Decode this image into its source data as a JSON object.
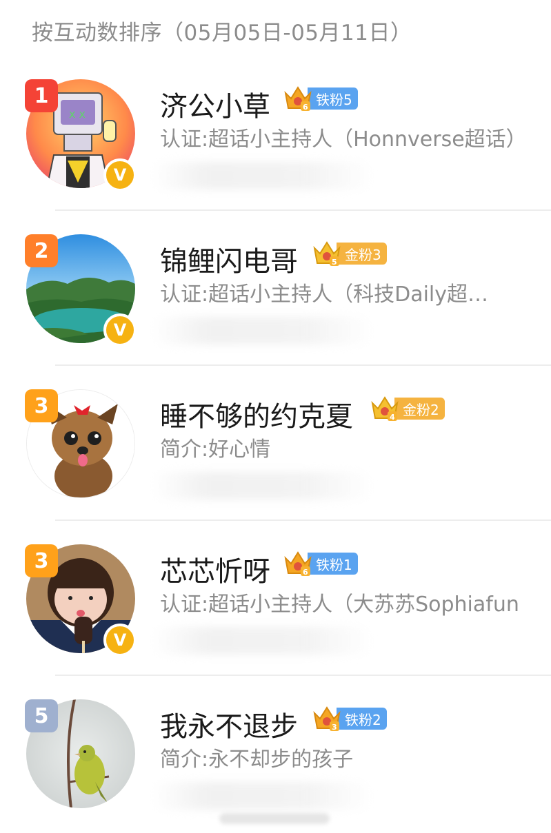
{
  "header": {
    "sort_text": "按互动数排序（05月05日-05月11日）"
  },
  "colors": {
    "rank_red": "#f44336",
    "rank_orange": "#ff7f2a",
    "rank_amber": "#ffa11a",
    "rank_gray": "#9fb0cf",
    "iron_fan": "#5aa3f0",
    "gold_fan": "#f5b340",
    "verified": "#f6b212"
  },
  "users": [
    {
      "rank": "1",
      "name": "济公小草",
      "fan_badge": "铁粉5",
      "fan_level_digit": "6",
      "desc": "认证:超话小主持人（Honnverse超话）",
      "verified": "V",
      "avatar_icon": "robot-avatar"
    },
    {
      "rank": "2",
      "name": "锦鲤闪电哥",
      "fan_badge": "金粉3",
      "fan_level_digit": "5",
      "desc": "认证:超话小主持人（科技Daily超…",
      "verified": "V",
      "avatar_icon": "landscape-avatar"
    },
    {
      "rank": "3",
      "name": "睡不够的约克夏",
      "fan_badge": "金粉2",
      "fan_level_digit": "4",
      "desc": "简介:好心情",
      "avatar_icon": "dog-avatar"
    },
    {
      "rank": "3",
      "name": "芯芯忻呀",
      "fan_badge": "铁粉1",
      "fan_level_digit": "6",
      "desc": "认证:超话小主持人（大苏苏Sophiafun",
      "verified": "V",
      "avatar_icon": "girl-avatar"
    },
    {
      "rank": "5",
      "name": "我永不退步",
      "fan_badge": "铁粉2",
      "fan_level_digit": "3",
      "desc": "简介:永不却步的孩子",
      "avatar_icon": "bird-avatar"
    }
  ]
}
